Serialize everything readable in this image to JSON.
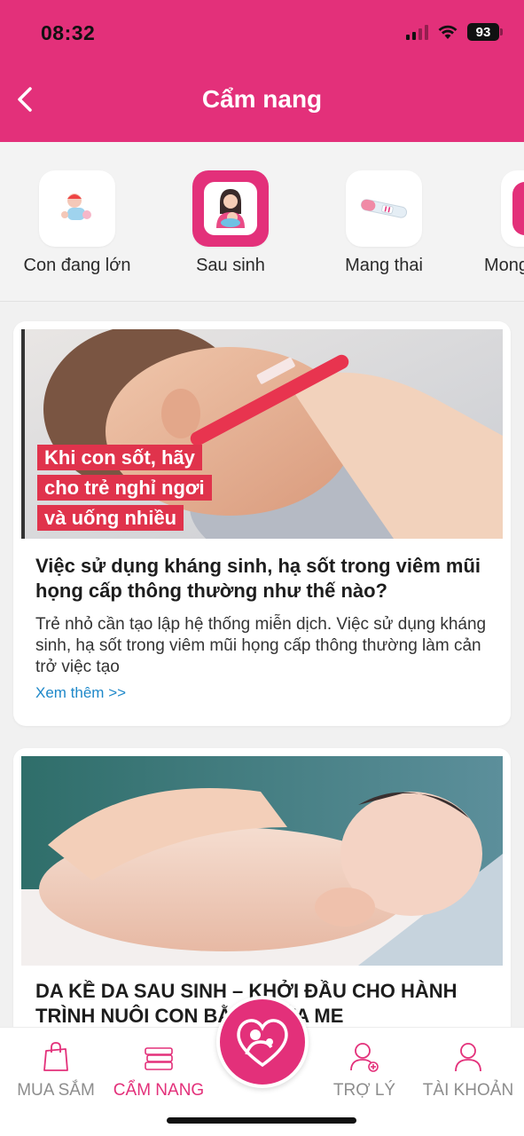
{
  "status": {
    "time": "08:32",
    "battery": "93"
  },
  "header": {
    "title": "Cẩm nang"
  },
  "categories": [
    {
      "label": "Con đang lớn",
      "icon": "baby-toy-icon"
    },
    {
      "label": "Sau sinh",
      "icon": "mother-baby-icon",
      "active": true
    },
    {
      "label": "Mang thai",
      "icon": "pregnancy-test-icon"
    },
    {
      "label": "Mong",
      "icon": "baby-icon"
    }
  ],
  "articles": [
    {
      "image_caption": [
        "Khi con sốt, hãy",
        "cho trẻ nghỉ ngơi",
        "và uống nhiều"
      ],
      "title": "Việc sử dụng kháng sinh, hạ sốt trong viêm mũi họng cấp thông thường như thế nào?",
      "excerpt": "Trẻ nhỏ cần tạo lập hệ thống miễn dịch. Việc sử dụng kháng sinh, hạ sốt trong viêm mũi họng cấp thông thường làm cản trở việc tạo",
      "more": "Xem thêm >>"
    },
    {
      "title": "DA KỀ DA SAU SINH – KHỞI ĐẦU CHO HÀNH TRÌNH NUÔI CON BẰNG SỮA ME"
    }
  ],
  "tabbar": {
    "items": [
      {
        "label": "MUA SẮM",
        "icon": "shopping-bag-icon"
      },
      {
        "label": "CẨM NANG",
        "icon": "books-icon",
        "active": true
      },
      {
        "label": "TRỢ LÝ",
        "icon": "assistant-icon"
      },
      {
        "label": "TÀI KHOẢN",
        "icon": "account-icon"
      }
    ],
    "center_icon": "mother-heart-icon"
  },
  "colors": {
    "brand": "#e3307a",
    "link": "#1e88c9"
  }
}
